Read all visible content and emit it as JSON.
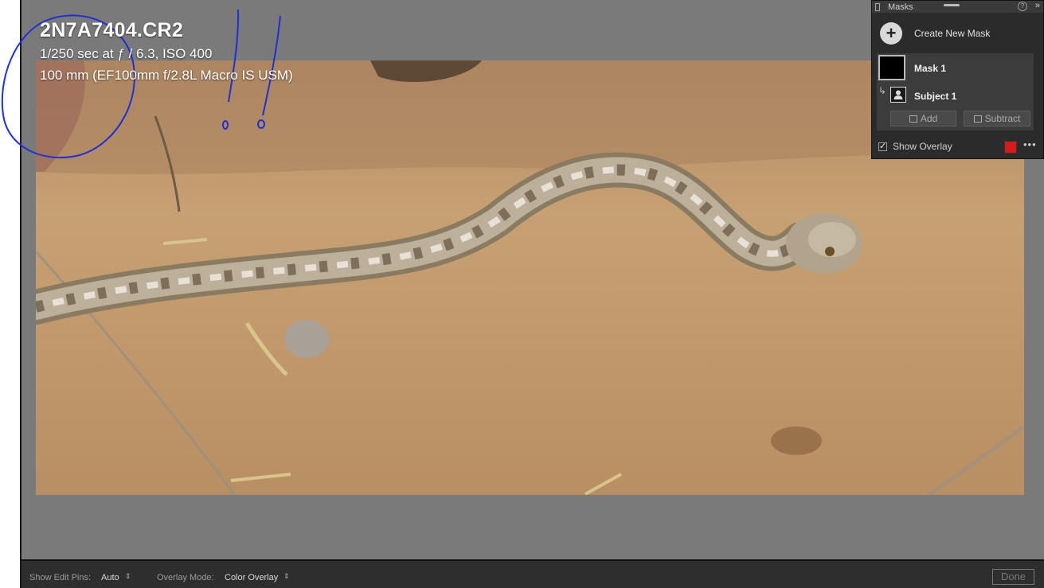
{
  "photo_info": {
    "filename": "2N7A7404.CR2",
    "exposure": "1/250 sec at ƒ / 6.3, ISO 400",
    "lens": "100 mm (EF100mm f/2.8L Macro IS USM)"
  },
  "masks_panel": {
    "title": "Masks",
    "help_icon": "question-icon",
    "create_new_mask_label": "Create New Mask",
    "masks": [
      {
        "name": "Mask 1",
        "components": [
          {
            "name": "Subject 1",
            "icon": "person-icon"
          }
        ]
      }
    ],
    "add_label": "Add",
    "subtract_label": "Subtract",
    "show_overlay_label": "Show Overlay",
    "show_overlay_checked": true,
    "overlay_color": "#d91a1a"
  },
  "toolbar": {
    "show_edit_pins_label": "Show Edit Pins:",
    "show_edit_pins_value": "Auto",
    "overlay_mode_label": "Overlay Mode:",
    "overlay_mode_value": "Color Overlay",
    "done_label": "Done"
  },
  "colors": {
    "app_background": "#7a7a7a",
    "panel_background": "#2b2b2b",
    "annotation_ink": "#1f2fd6"
  }
}
